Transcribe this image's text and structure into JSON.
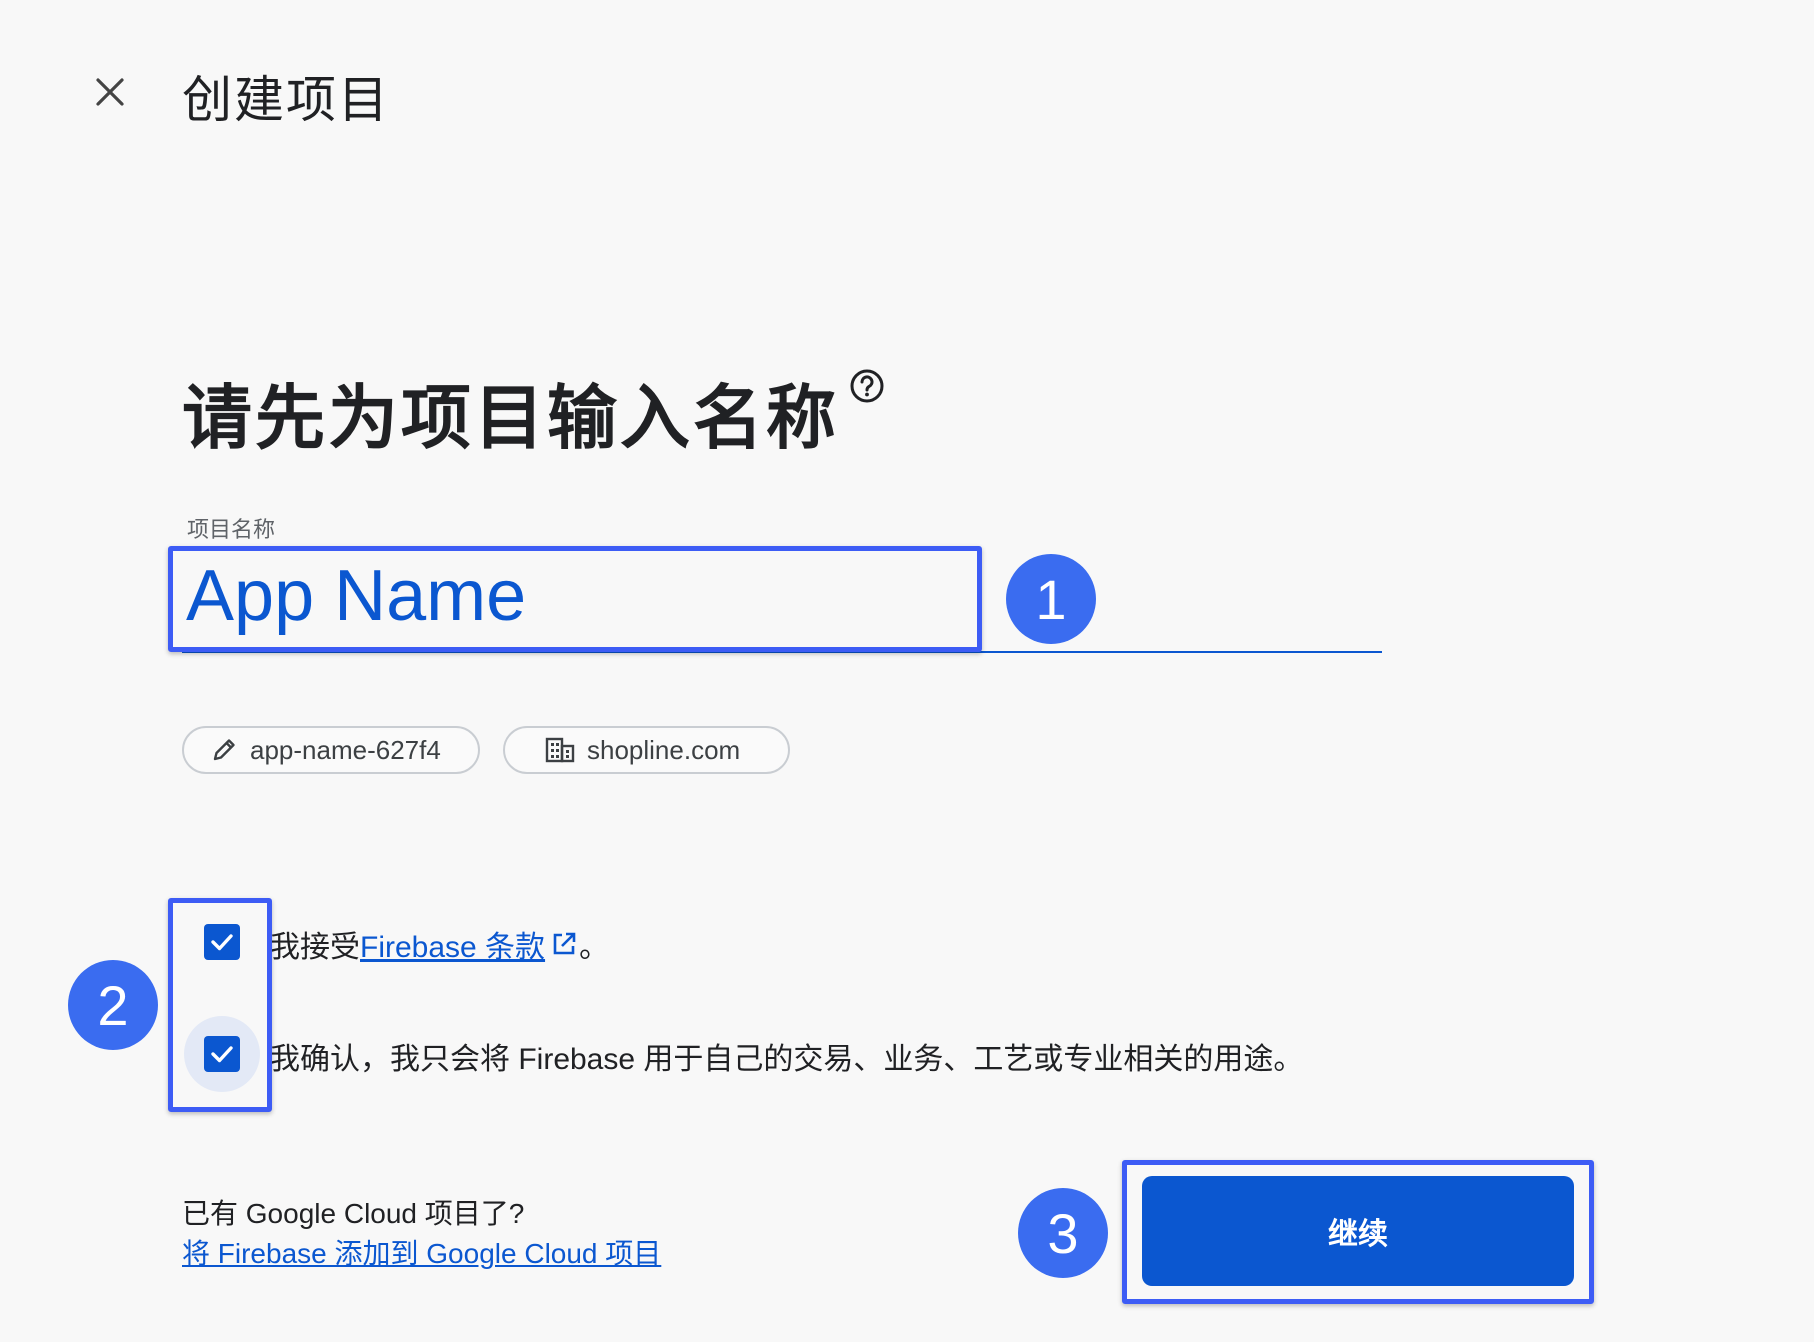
{
  "header": {
    "title": "创建项目",
    "close_icon": "close-icon"
  },
  "heading": {
    "text": "请先为项目输入名称",
    "help_icon": "help-icon"
  },
  "project_field": {
    "label": "项目名称",
    "value": "App Name"
  },
  "chips": {
    "project_id": "app-name-627f4",
    "project_id_icon": "pencil-icon",
    "organization": "shopline.com",
    "organization_icon": "building-icon"
  },
  "terms": {
    "accept_prefix": "我接受 ",
    "accept_link": "Firebase 条款",
    "accept_suffix": "。",
    "accept_checked": true,
    "confirm_text": "我确认，我只会将 Firebase 用于自己的交易、业务、工艺或专业相关的用途。",
    "confirm_checked": true
  },
  "footer": {
    "question": "已有 Google Cloud 项目了?",
    "link": "将 Firebase 添加到 Google Cloud 项目",
    "continue_label": "继续"
  },
  "annotations": {
    "badge_1": "1",
    "badge_2": "2",
    "badge_3": "3"
  },
  "colors": {
    "accent": "#0b57d0",
    "annotation": "#3a6cf0"
  }
}
